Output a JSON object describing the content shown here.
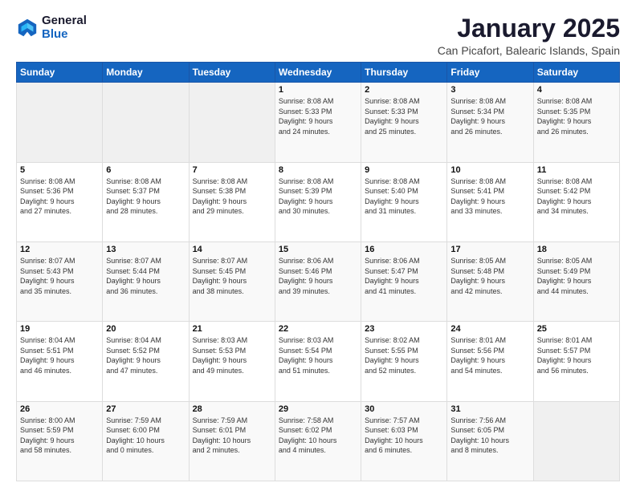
{
  "logo": {
    "general": "General",
    "blue": "Blue"
  },
  "title": "January 2025",
  "subtitle": "Can Picafort, Balearic Islands, Spain",
  "headers": [
    "Sunday",
    "Monday",
    "Tuesday",
    "Wednesday",
    "Thursday",
    "Friday",
    "Saturday"
  ],
  "weeks": [
    [
      {
        "day": "",
        "info": ""
      },
      {
        "day": "",
        "info": ""
      },
      {
        "day": "",
        "info": ""
      },
      {
        "day": "1",
        "info": "Sunrise: 8:08 AM\nSunset: 5:33 PM\nDaylight: 9 hours\nand 24 minutes."
      },
      {
        "day": "2",
        "info": "Sunrise: 8:08 AM\nSunset: 5:33 PM\nDaylight: 9 hours\nand 25 minutes."
      },
      {
        "day": "3",
        "info": "Sunrise: 8:08 AM\nSunset: 5:34 PM\nDaylight: 9 hours\nand 26 minutes."
      },
      {
        "day": "4",
        "info": "Sunrise: 8:08 AM\nSunset: 5:35 PM\nDaylight: 9 hours\nand 26 minutes."
      }
    ],
    [
      {
        "day": "5",
        "info": "Sunrise: 8:08 AM\nSunset: 5:36 PM\nDaylight: 9 hours\nand 27 minutes."
      },
      {
        "day": "6",
        "info": "Sunrise: 8:08 AM\nSunset: 5:37 PM\nDaylight: 9 hours\nand 28 minutes."
      },
      {
        "day": "7",
        "info": "Sunrise: 8:08 AM\nSunset: 5:38 PM\nDaylight: 9 hours\nand 29 minutes."
      },
      {
        "day": "8",
        "info": "Sunrise: 8:08 AM\nSunset: 5:39 PM\nDaylight: 9 hours\nand 30 minutes."
      },
      {
        "day": "9",
        "info": "Sunrise: 8:08 AM\nSunset: 5:40 PM\nDaylight: 9 hours\nand 31 minutes."
      },
      {
        "day": "10",
        "info": "Sunrise: 8:08 AM\nSunset: 5:41 PM\nDaylight: 9 hours\nand 33 minutes."
      },
      {
        "day": "11",
        "info": "Sunrise: 8:08 AM\nSunset: 5:42 PM\nDaylight: 9 hours\nand 34 minutes."
      }
    ],
    [
      {
        "day": "12",
        "info": "Sunrise: 8:07 AM\nSunset: 5:43 PM\nDaylight: 9 hours\nand 35 minutes."
      },
      {
        "day": "13",
        "info": "Sunrise: 8:07 AM\nSunset: 5:44 PM\nDaylight: 9 hours\nand 36 minutes."
      },
      {
        "day": "14",
        "info": "Sunrise: 8:07 AM\nSunset: 5:45 PM\nDaylight: 9 hours\nand 38 minutes."
      },
      {
        "day": "15",
        "info": "Sunrise: 8:06 AM\nSunset: 5:46 PM\nDaylight: 9 hours\nand 39 minutes."
      },
      {
        "day": "16",
        "info": "Sunrise: 8:06 AM\nSunset: 5:47 PM\nDaylight: 9 hours\nand 41 minutes."
      },
      {
        "day": "17",
        "info": "Sunrise: 8:05 AM\nSunset: 5:48 PM\nDaylight: 9 hours\nand 42 minutes."
      },
      {
        "day": "18",
        "info": "Sunrise: 8:05 AM\nSunset: 5:49 PM\nDaylight: 9 hours\nand 44 minutes."
      }
    ],
    [
      {
        "day": "19",
        "info": "Sunrise: 8:04 AM\nSunset: 5:51 PM\nDaylight: 9 hours\nand 46 minutes."
      },
      {
        "day": "20",
        "info": "Sunrise: 8:04 AM\nSunset: 5:52 PM\nDaylight: 9 hours\nand 47 minutes."
      },
      {
        "day": "21",
        "info": "Sunrise: 8:03 AM\nSunset: 5:53 PM\nDaylight: 9 hours\nand 49 minutes."
      },
      {
        "day": "22",
        "info": "Sunrise: 8:03 AM\nSunset: 5:54 PM\nDaylight: 9 hours\nand 51 minutes."
      },
      {
        "day": "23",
        "info": "Sunrise: 8:02 AM\nSunset: 5:55 PM\nDaylight: 9 hours\nand 52 minutes."
      },
      {
        "day": "24",
        "info": "Sunrise: 8:01 AM\nSunset: 5:56 PM\nDaylight: 9 hours\nand 54 minutes."
      },
      {
        "day": "25",
        "info": "Sunrise: 8:01 AM\nSunset: 5:57 PM\nDaylight: 9 hours\nand 56 minutes."
      }
    ],
    [
      {
        "day": "26",
        "info": "Sunrise: 8:00 AM\nSunset: 5:59 PM\nDaylight: 9 hours\nand 58 minutes."
      },
      {
        "day": "27",
        "info": "Sunrise: 7:59 AM\nSunset: 6:00 PM\nDaylight: 10 hours\nand 0 minutes."
      },
      {
        "day": "28",
        "info": "Sunrise: 7:59 AM\nSunset: 6:01 PM\nDaylight: 10 hours\nand 2 minutes."
      },
      {
        "day": "29",
        "info": "Sunrise: 7:58 AM\nSunset: 6:02 PM\nDaylight: 10 hours\nand 4 minutes."
      },
      {
        "day": "30",
        "info": "Sunrise: 7:57 AM\nSunset: 6:03 PM\nDaylight: 10 hours\nand 6 minutes."
      },
      {
        "day": "31",
        "info": "Sunrise: 7:56 AM\nSunset: 6:05 PM\nDaylight: 10 hours\nand 8 minutes."
      },
      {
        "day": "",
        "info": ""
      }
    ]
  ]
}
